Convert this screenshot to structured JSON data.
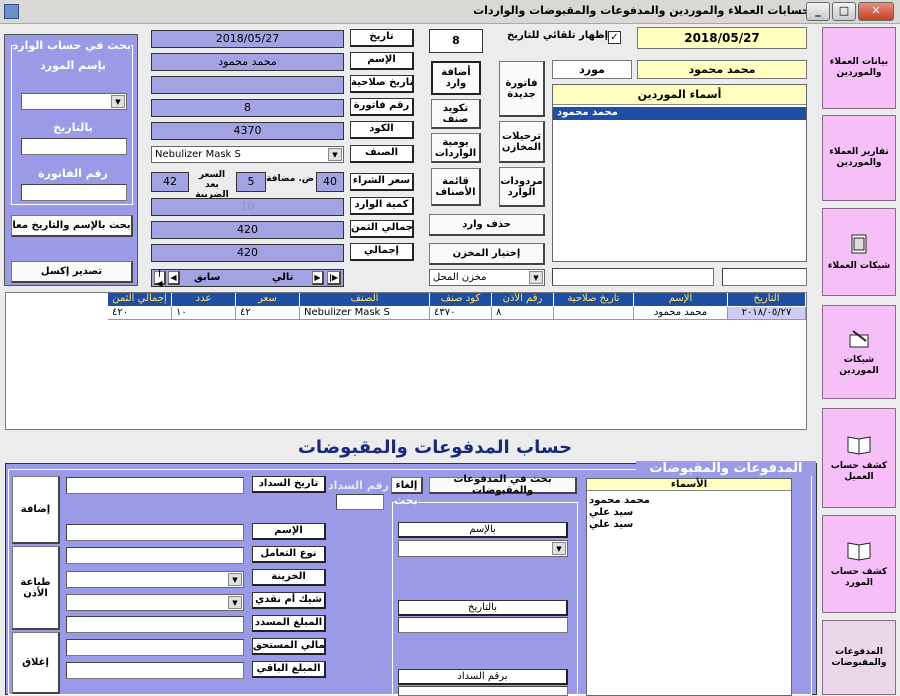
{
  "window": {
    "title": "حسابات    العملاء والموردين والمدفوعات والمقبوضات والواردات",
    "minimize": "_",
    "maximize": "□",
    "close": "✕"
  },
  "left_search": {
    "title": "بحث في حساب الوارد",
    "by_supplier": "بإسم المورد",
    "by_date": "بالتاريخ",
    "by_invoice": "رقم الفاتورة",
    "search_both": "بحث بالإسم والتاريخ معا",
    "export_excel": "تصدير إكسل"
  },
  "form": {
    "date_label": "تاريخ",
    "date_value": "2018/05/27",
    "name_label": "الإسم",
    "name_value": "محمد محمود",
    "expiry_label": "تاريخ صلاحية",
    "expiry_value": "",
    "invoice_label": "رقم فاتورة",
    "invoice_value": "8",
    "code_label": "الكود",
    "code_value": "4370",
    "category_label": "الصنف",
    "category_value": "Nebulizer Mask S",
    "buy_price_label": "سعر الشراء",
    "buy_price_value": "40",
    "tax_label": "ض. مضافة",
    "tax_value": "5",
    "after_tax_label": "السعر بعد الضريبة",
    "after_tax_value": "42",
    "qty_label": "كمية الوارد",
    "qty_value": "10",
    "total_price_label": "إجمالي الثمن",
    "total_price_value": "420",
    "total_label": "إجمالي",
    "total_value": "420",
    "next_label": "تالي",
    "prev_label": "سابق"
  },
  "mid": {
    "counter": "8",
    "add_incoming": "أضافة وارد",
    "new_invoice": "فاتورة جديدة",
    "category_code": "تكويد صنف",
    "store_transfers": "ترحيلات المخازن",
    "daily_incoming": "يومية الواردات",
    "incoming_returns": "مردودات الوارد",
    "categories_list": "قائمة الأصناف",
    "delete_incoming": "حذف وارد",
    "choose_store": "إختيار المخزن",
    "store_value": "مخزن المحل"
  },
  "right": {
    "auto_show_label": "إظهار تلقائي للتاريخ",
    "auto_show_checked": "✓",
    "date_display": "2018/05/27",
    "supplier_name": "محمد محمود",
    "supplier_type": "مورد",
    "suppliers_header": "أسماء الموردين",
    "suppliers": [
      "محمد محمود"
    ]
  },
  "sidebar": [
    {
      "label": "بيانات العملاء والموردين",
      "icon": "none"
    },
    {
      "label": "تقارير العملاء والموردين",
      "icon": "none"
    },
    {
      "label": "شيكات العملاء",
      "icon": "document-icon"
    },
    {
      "label": "شيكات الموردين",
      "icon": "signing-icon"
    },
    {
      "label": "كشف حساب العميل",
      "icon": "book-icon"
    },
    {
      "label": "كشف حساب المورد",
      "icon": "book-icon"
    },
    {
      "label": "المدفوعات والمقبوضات",
      "icon": "none"
    }
  ],
  "grid": {
    "headers": [
      "التاريخ",
      "الإسم",
      "تاريخ صلاحية",
      "رقم الأذن",
      "كود صنف",
      "الصنف",
      "سعر",
      "عدد",
      "إجمالي الثمن"
    ],
    "rows": [
      [
        "٢٠١٨/٠٥/٢٧",
        "محمد محمود",
        "",
        "٨",
        "٤٣٧٠",
        "Nebulizer Mask S",
        "٤٢",
        "١٠",
        "٤٢٠"
      ]
    ]
  },
  "payments": {
    "section_title": "حساب المدفوعات والمقبوضات",
    "group_title": "المدفوعات والمقبوضات",
    "names_header": "الأسماء",
    "names": [
      "محمد محمود",
      "سيد علي",
      "سيد علي"
    ],
    "search_label": "بحث في المدفوعات والمقبوضات",
    "search_group": "بحث",
    "by_name": "بالإسم",
    "by_date": "بالتاريخ",
    "by_payment_no": "برقم السداد",
    "cancel": "إلغاء",
    "payment_no": "رقم السداد",
    "payment_date": "تاريخ السداد",
    "name": "الإسم",
    "deal_type": "نوع التعامل",
    "treasury": "الخزينة",
    "check_or_cash": "شيك أم نقدي",
    "paid_amount": "المبلغ المسدد",
    "total_due": "إجمالي المستحق",
    "remaining": "المبلغ الباقي",
    "add": "إضافة",
    "print_permit": "طباعة الأذن",
    "close": "إغلاق"
  },
  "colors": {
    "panel": "#a3a3e4",
    "header": "#1f4fa5",
    "sidebar": "#f7bff7",
    "highlight": "#ffffc0"
  }
}
